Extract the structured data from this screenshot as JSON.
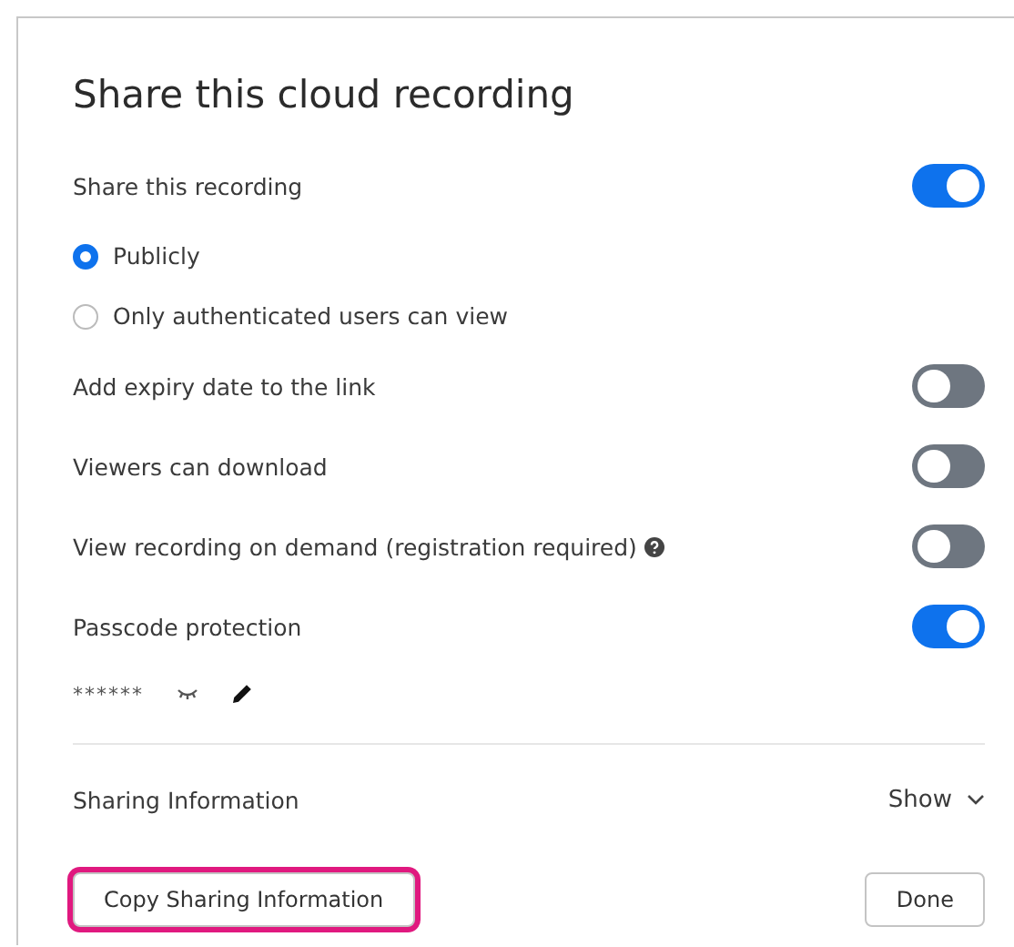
{
  "dialog": {
    "title": "Share this cloud recording",
    "settings": [
      {
        "kind": "toggle",
        "label": "Share this recording",
        "on": true
      },
      {
        "kind": "radio",
        "label": "Publicly",
        "selected": true
      },
      {
        "kind": "radio",
        "label": "Only authenticated users can view",
        "selected": false
      },
      {
        "kind": "toggle",
        "label": "Add expiry date to the link",
        "on": false
      },
      {
        "kind": "toggle",
        "label": "Viewers can download",
        "on": false
      },
      {
        "kind": "toggle",
        "label": "View recording on demand (registration required)",
        "on": false,
        "help": true
      },
      {
        "kind": "toggle",
        "label": "Passcode protection",
        "on": true
      }
    ],
    "passcode": {
      "value": "******",
      "editable": true
    },
    "sharing_info": {
      "label": "Sharing Information",
      "toggle_label": "Show",
      "expanded": false
    },
    "buttons": [
      {
        "label": "Copy Sharing Information",
        "highlighted": true
      },
      {
        "label": "Done",
        "highlighted": false
      }
    ]
  }
}
